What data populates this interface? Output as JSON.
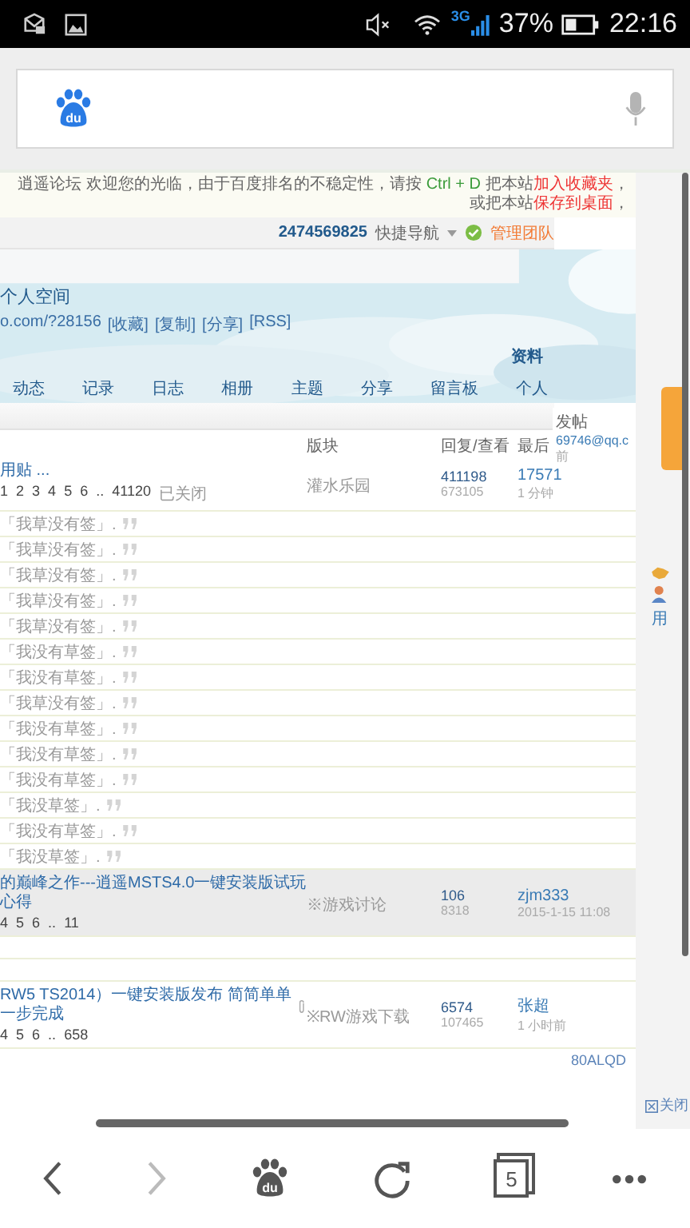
{
  "status_bar": {
    "network": "3G",
    "battery": "37%",
    "time": "22:16"
  },
  "search_bar": {
    "logo_text": "du"
  },
  "notice": {
    "segments": [
      {
        "kind": "text",
        "text": "逍遥论坛 欢迎您的光临，由于百度排名的不稳定性，请按"
      },
      {
        "kind": "key",
        "text": "Ctrl + D"
      },
      {
        "kind": "text",
        "text": "把本站"
      },
      {
        "kind": "link",
        "text": "加入收藏夹"
      },
      {
        "kind": "text",
        "text": "，或把本站"
      },
      {
        "kind": "link",
        "text": "保存到桌面"
      },
      {
        "kind": "text",
        "text": "，"
      }
    ]
  },
  "top_nav": {
    "user_id": "2474569825",
    "quick_nav": "快捷导航",
    "admin_link": "管理团队"
  },
  "space": {
    "title": "个人空间",
    "url": "o.com/?28156",
    "actions": [
      "[收藏]",
      "[复制]",
      "[分享]",
      "[RSS]"
    ],
    "profile_link": "资料",
    "tabs": [
      {
        "label": "动态",
        "selected": false
      },
      {
        "label": "记录",
        "selected": false
      },
      {
        "label": "日志",
        "selected": false
      },
      {
        "label": "相册",
        "selected": false
      },
      {
        "label": "主题",
        "selected": false
      },
      {
        "label": "分享",
        "selected": false
      },
      {
        "label": "留言板",
        "selected": false
      },
      {
        "label": "个人",
        "selected": false
      }
    ]
  },
  "threads": {
    "columns": [
      "版块",
      "回复/查看",
      "最后"
    ],
    "rows": [
      {
        "kind": "thread",
        "highlighted": false,
        "attachment": false,
        "title": "用贴 ...",
        "pages": [
          "1",
          "2",
          "3",
          "4",
          "5",
          "6",
          "..",
          "41120"
        ],
        "status": "已关闭",
        "forum": "灌水乐园",
        "replies": "411198",
        "views": "673105",
        "author": "17571",
        "time": "1 分钟"
      },
      {
        "kind": "quote",
        "text": "「我草没有签」."
      },
      {
        "kind": "quote",
        "text": "「我草没有签」."
      },
      {
        "kind": "quote",
        "text": "「我草没有签」."
      },
      {
        "kind": "quote",
        "text": "「我草没有签」."
      },
      {
        "kind": "quote",
        "text": "「我草没有签」."
      },
      {
        "kind": "quote",
        "text": "「我没有草签」."
      },
      {
        "kind": "quote",
        "text": "「我没有草签」."
      },
      {
        "kind": "quote",
        "text": "「我草没有签」."
      },
      {
        "kind": "quote",
        "text": "「我没有草签」."
      },
      {
        "kind": "quote",
        "text": "「我没有草签」."
      },
      {
        "kind": "quote",
        "text": "「我没有草签」."
      },
      {
        "kind": "quote",
        "text": "「我没草签」."
      },
      {
        "kind": "quote",
        "text": "「我没有草签」."
      },
      {
        "kind": "quote",
        "text": "「我没草签」."
      },
      {
        "kind": "thread",
        "highlighted": true,
        "attachment": false,
        "title": "的巅峰之作---逍遥MSTS4.0一键安装版试玩心得",
        "pages": [
          "4",
          "5",
          "6",
          "..",
          "11"
        ],
        "forum": "※游戏讨论",
        "replies": "106",
        "views": "8318",
        "author": "zjm333",
        "time": "2015-1-15 11:08"
      },
      {
        "kind": "blank"
      },
      {
        "kind": "blank"
      },
      {
        "kind": "thread",
        "highlighted": false,
        "attachment": true,
        "title": "RW5 TS2014）一键安装版发布 简简单单一步完成",
        "pages": [
          "4",
          "5",
          "6",
          "..",
          "658"
        ],
        "forum": "※RW游戏下载",
        "replies": "6574",
        "views": "107465",
        "author": "张超",
        "time": "1 小时前"
      }
    ]
  },
  "side_box": {
    "title": "发帖",
    "email": "69746@qq.c",
    "time": "前"
  },
  "sidebar": {
    "link": "用"
  },
  "footer": {
    "code": "80ALQD",
    "close": "关闭"
  },
  "toolbar": {
    "logo_text": "du",
    "tab_count": "5",
    "forward_disabled": true
  }
}
